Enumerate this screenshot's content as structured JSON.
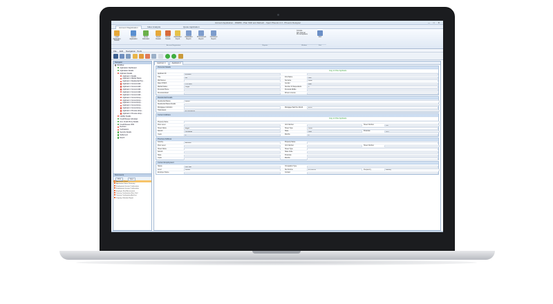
{
  "window": {
    "title": "Account Application - DMMM - Plan Shift and Refresh - Xpert Phoenix 2.3 - Phoenix Designer"
  },
  "ribbon_tabs": [
    "Account Registration",
    "Index Analysis",
    "Quote Application"
  ],
  "ribbon": {
    "buttons": [
      {
        "label": "Load Application Details",
        "icon": "load-icon",
        "color": "#e6a83a"
      },
      {
        "label": "Search Application",
        "icon": "search-icon",
        "color": "#5a8fd0"
      },
      {
        "label": "Quote Calculator",
        "icon": "calculator-icon",
        "color": "#6bb04a"
      },
      {
        "label": "Import Details",
        "icon": "import-icon",
        "color": "#e6a83a"
      },
      {
        "label": "Export Details",
        "icon": "export-icon",
        "color": "#d86a3a"
      },
      {
        "label": "Application Import",
        "icon": "folder-icon",
        "color": "#e6c24a"
      },
      {
        "label": "Application Report",
        "icon": "report-icon",
        "color": "#7d9ccc"
      },
      {
        "label": "Procurement Report",
        "icon": "report-icon",
        "color": "#7d9ccc"
      },
      {
        "label": "Combined Report",
        "icon": "report-icon",
        "color": "#7d9ccc"
      }
    ],
    "checks": [
      "Console",
      "Non Internal",
      "Pre Acceptance"
    ],
    "exit_label": "Exit",
    "groups": [
      "Account Registration",
      "Reports",
      "Window",
      "Exit"
    ]
  },
  "menu": [
    "File",
    "Edit",
    "Navigation",
    "Tools"
  ],
  "navigator": {
    "title": "Navigator",
    "items": [
      {
        "label": "Workflow",
        "level": 0,
        "color": "#7a7a7a"
      },
      {
        "label": "Application Dashboard",
        "level": 1,
        "color": "#3aa23a"
      },
      {
        "label": "Application Details",
        "level": 1,
        "color": "#3aa23a"
      },
      {
        "label": "Applicant Details",
        "level": 1,
        "color": "#e04a3a"
      },
      {
        "label": "Applicant 1 Details",
        "level": 2,
        "color": "#e04a3a"
      },
      {
        "label": "Applicant 1 Marital Status",
        "level": 2,
        "color": "#e04a3a"
      },
      {
        "label": "Applicant 1 Residential Hist...",
        "level": 2,
        "color": "#e04a3a"
      },
      {
        "label": "Applicant 1 Current Addr...",
        "level": 2,
        "color": "#e04a3a"
      },
      {
        "label": "Applicant 1 Current Addr...",
        "level": 2,
        "color": "#e04a3a"
      },
      {
        "label": "Applicant 1 Current Addr...",
        "level": 2,
        "color": "#e04a3a"
      },
      {
        "label": "Applicant 1 Current Addr...",
        "level": 2,
        "color": "#e04a3a"
      },
      {
        "label": "Applicant 1 Current Addr...",
        "level": 2,
        "color": "#e04a3a"
      },
      {
        "label": "Applicant 1 Current Emp...",
        "level": 2,
        "color": "#e04a3a"
      },
      {
        "label": "Applicant 1 Current Emp...",
        "level": 2,
        "color": "#e04a3a"
      },
      {
        "label": "Applicant 1 Current Emp...",
        "level": 2,
        "color": "#e04a3a"
      },
      {
        "label": "Applicant 1 Current Emp...",
        "level": 2,
        "color": "#e04a3a"
      },
      {
        "label": "Applicant 1 Current Emp...",
        "level": 2,
        "color": "#e04a3a"
      },
      {
        "label": "Applicant 1 Previous Emp...",
        "level": 2,
        "color": "#e04a3a"
      },
      {
        "label": "Applicant 1 Previous Emp...",
        "level": 2,
        "color": "#e04a3a"
      },
      {
        "label": "Liability Details",
        "level": 1,
        "color": "#e04a3a"
      },
      {
        "label": "Credit Bureau Individual",
        "level": 1,
        "color": "#3aa23a"
      },
      {
        "label": "Gov. Credit Proxy Details",
        "level": 1,
        "color": "#3aa23a"
      },
      {
        "label": "Credit Bureau VMS",
        "level": 1,
        "color": "#3aa23a"
      },
      {
        "label": "Decision",
        "level": 1,
        "color": "#e04a3a"
      },
      {
        "label": "Verifications",
        "level": 1,
        "color": "#e04a3a"
      },
      {
        "label": "Security Details",
        "level": 1,
        "color": "#3aa23a"
      },
      {
        "label": "Settlement",
        "level": 1,
        "color": "#3aa23a"
      },
      {
        "label": "Export",
        "level": 1,
        "color": "#3aa23a"
      }
    ]
  },
  "documents": {
    "title": "Documents",
    "buttons": [
      "Print",
      "Open"
    ],
    "items": [
      "Application Sheet",
      "Application Status Summary",
      "Employment Income Confirmation",
      "Employment Income Confirmation",
      "Employer Final Assessment",
      "Tenancy Confirmation Rent Verif",
      "Tenancy Confirmation And Inst",
      "Property Valuation Report"
    ],
    "selected_index": 0
  },
  "form_tabs": [
    "Applicant 1",
    "Applicant 2"
  ],
  "sections": {
    "personal": {
      "title": "Personal Details",
      "link": "Copy to Other Applicants",
      "rows": [
        [
          {
            "label": "Applicant ID",
            "value": "8518465"
          },
          {
            "label": "",
            "value": ""
          }
        ],
        [
          {
            "label": "Title",
            "value": "Ms"
          },
          {
            "label": "First Name",
            "value": "Paul"
          }
        ],
        [
          {
            "label": "Mid Names",
            "value": ""
          },
          {
            "label": "Surname",
            "value": "Smith"
          }
        ],
        [
          {
            "label": "Date Of Birth",
            "value": "1/11/1985"
          },
          {
            "label": "Gender",
            "value": "Male"
          }
        ],
        [
          {
            "label": "Marital Status",
            "value": "Single"
          },
          {
            "label": "Number Of Dependants",
            "value": "0"
          }
        ],
        [
          {
            "label": "Personal Phone",
            "value": ""
          },
          {
            "label": "Personal Mobile",
            "value": ""
          }
        ],
        [
          {
            "label": "Personal Email",
            "value": ""
          },
          {
            "label": "Drivers Licence",
            "value": ""
          }
        ]
      ]
    },
    "residential": {
      "title": "Residential Details",
      "rows": [
        [
          {
            "label": "Residential Status",
            "value": "Renter"
          }
        ],
        [
          {
            "label": "Residential Status Details",
            "value": ""
          }
        ],
        [
          {
            "label": "Mortgagee Institution",
            "value": ""
          },
          {
            "label": "Mortgage Paid Per Month",
            "value": "$0.00"
          }
        ],
        [
          {
            "label": "Total Assets",
            "value": "$1,200,000.00"
          }
        ]
      ]
    },
    "current_address": {
      "title": "Current Address",
      "link": "Copy to Other Applicants",
      "rows": [
        [
          {
            "label": "Property Name",
            "value": ""
          }
        ],
        [
          {
            "label": "Floor Level",
            "value": ""
          },
          {
            "label": "Unit Number",
            "value": ""
          },
          {
            "label": "Street Number",
            "value": "120"
          }
        ],
        [
          {
            "label": "Street Name",
            "value": "Argyle"
          },
          {
            "label": "Street Type",
            "value": "Street"
          }
        ],
        [
          {
            "label": "Suburb",
            "value": "Docklands"
          },
          {
            "label": "State",
            "value": "NSW"
          },
          {
            "label": "Postcode",
            "value": "2017"
          }
        ],
        [
          {
            "label": "Years",
            "value": "0"
          },
          {
            "label": "Months",
            "value": "0"
          }
        ]
      ]
    },
    "previous_address": {
      "title": "Previous Address",
      "rows": [
        [
          {
            "label": "Country",
            "value": "Australia"
          },
          {
            "label": "Property Name",
            "value": ""
          }
        ],
        [
          {
            "label": "Floor Level",
            "value": ""
          },
          {
            "label": "Unit Number",
            "value": ""
          },
          {
            "label": "Street Number",
            "value": ""
          }
        ],
        [
          {
            "label": "Street Name",
            "value": ""
          },
          {
            "label": "Street Type",
            "value": ""
          }
        ],
        [
          {
            "label": "Suburb",
            "value": ""
          },
          {
            "label": "State Code",
            "value": ""
          }
        ],
        [
          {
            "label": "State",
            "value": ""
          },
          {
            "label": "Postcode",
            "value": ""
          }
        ],
        [
          {
            "label": "Years",
            "value": ""
          },
          {
            "label": "Months",
            "value": ""
          }
        ]
      ]
    },
    "employment": {
      "title": "Current Employment",
      "rows": [
        [
          {
            "label": "Status",
            "value": "Full Time"
          },
          {
            "label": "Occupation Type",
            "value": ""
          }
        ],
        [
          {
            "label": "Level",
            "value": "Worker"
          },
          {
            "label": "Net Income",
            "value": "$74,000.00"
          },
          {
            "label": "Frequency",
            "value": "Monthly"
          }
        ],
        [
          {
            "label": "Employer Name",
            "value": ""
          },
          {
            "label": "Contact",
            "value": ""
          }
        ]
      ]
    }
  }
}
